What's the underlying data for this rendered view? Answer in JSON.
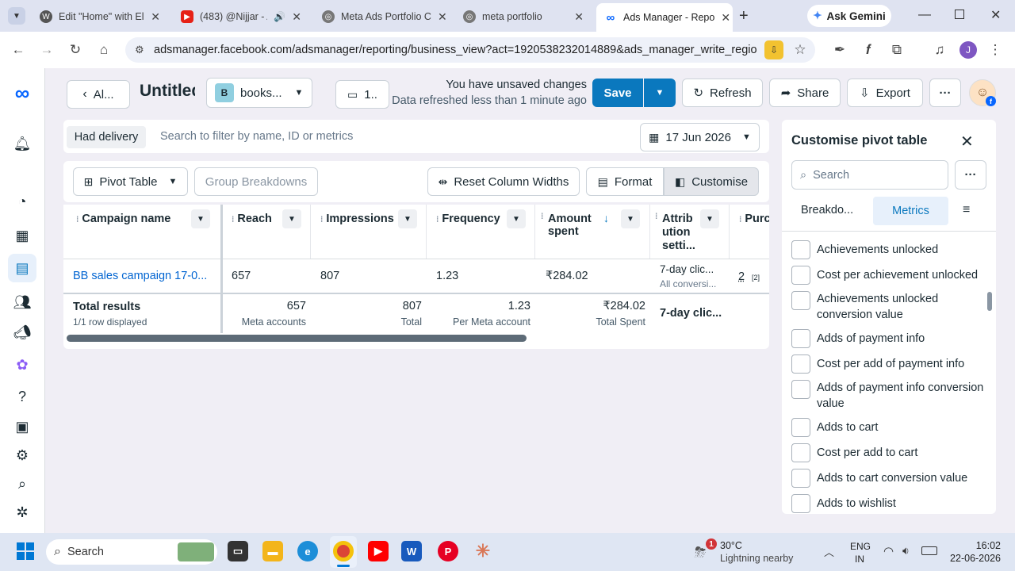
{
  "browser": {
    "tabs": [
      {
        "title": "Edit \"Home\" with El",
        "icon": "wordpress-icon"
      },
      {
        "title": "(483) @Nijjar - A",
        "icon": "youtube-icon"
      },
      {
        "title": "Meta Ads Portfolio C",
        "icon": "globe-icon"
      },
      {
        "title": "meta portfolio",
        "icon": "globe-icon"
      },
      {
        "title": "Ads Manager - Repo",
        "icon": "meta-icon"
      }
    ],
    "gemini_label": "Ask Gemini",
    "url": "adsmanager.facebook.com/adsmanager/reporting/business_view?act=1920538232014889&ads_manager_write_regions=...",
    "profile_initial": "J"
  },
  "header": {
    "back_label": "Al...",
    "report_title": "Untitled",
    "account_initial": "B",
    "account_name": "books...",
    "views_label": "1..",
    "unsaved_text": "You have unsaved changes",
    "refreshed_text": "Data refreshed less than 1 minute ago",
    "save_label": "Save",
    "refresh_label": "Refresh",
    "share_label": "Share",
    "export_label": "Export",
    "more_label": "···"
  },
  "filter": {
    "chip_label": "Had delivery",
    "search_placeholder": "Search to filter by name, ID or metrics",
    "date_label": "17 Jun 2026"
  },
  "toolbar2": {
    "pivot_label": "Pivot Table",
    "group_label": "Group Breakdowns",
    "reset_label": "Reset Column Widths",
    "format_label": "Format",
    "customise_label": "Customise"
  },
  "table": {
    "columns": [
      "Campaign name",
      "Reach",
      "Impressions",
      "Frequency",
      "Amount spent",
      "Attribution setti...",
      "Purch"
    ],
    "attribution_header": [
      "Attrib",
      "ution",
      "setti..."
    ],
    "row": {
      "campaign": "BB sales campaign 17-0...",
      "reach": "657",
      "impressions": "807",
      "frequency": "1.23",
      "amount": "₹284.02",
      "attribution": "7-day clic...",
      "attribution_sub": "All conversi...",
      "purchases": "2",
      "purchases_note": "[2]"
    },
    "total": {
      "label": "Total results",
      "sub": "1/1 row displayed",
      "reach": "657",
      "reach_sub": "Meta accounts",
      "impressions": "807",
      "impressions_sub": "Total",
      "frequency": "1.23",
      "frequency_sub": "Per Meta account",
      "amount": "₹284.02",
      "amount_sub": "Total Spent",
      "attribution": "7-day clic..."
    }
  },
  "panel": {
    "title": "Customise pivot table",
    "search_placeholder": "Search",
    "more_label": "···",
    "tab_breakdowns": "Breakdo...",
    "tab_metrics": "Metrics",
    "metrics": [
      "Achievements unlocked",
      "Cost per achievement unlocked",
      "Achievements unlocked conversion value",
      "Adds of payment info",
      "Cost per add of payment info",
      "Adds of payment info conversion value",
      "Adds to cart",
      "Cost per add to cart",
      "Adds to cart conversion value",
      "Adds to wishlist"
    ]
  },
  "taskbar": {
    "search_label": "Search",
    "weather_temp": "30°C",
    "weather_desc": "Lightning nearby",
    "weather_badge": "1",
    "lang_top": "ENG",
    "lang_bottom": "IN",
    "time": "16:02",
    "date": "22-06-2026"
  },
  "colors": {
    "accent": "#0a78be",
    "link": "#0064d1",
    "selected_tab_bg": "#e7f0fb"
  }
}
